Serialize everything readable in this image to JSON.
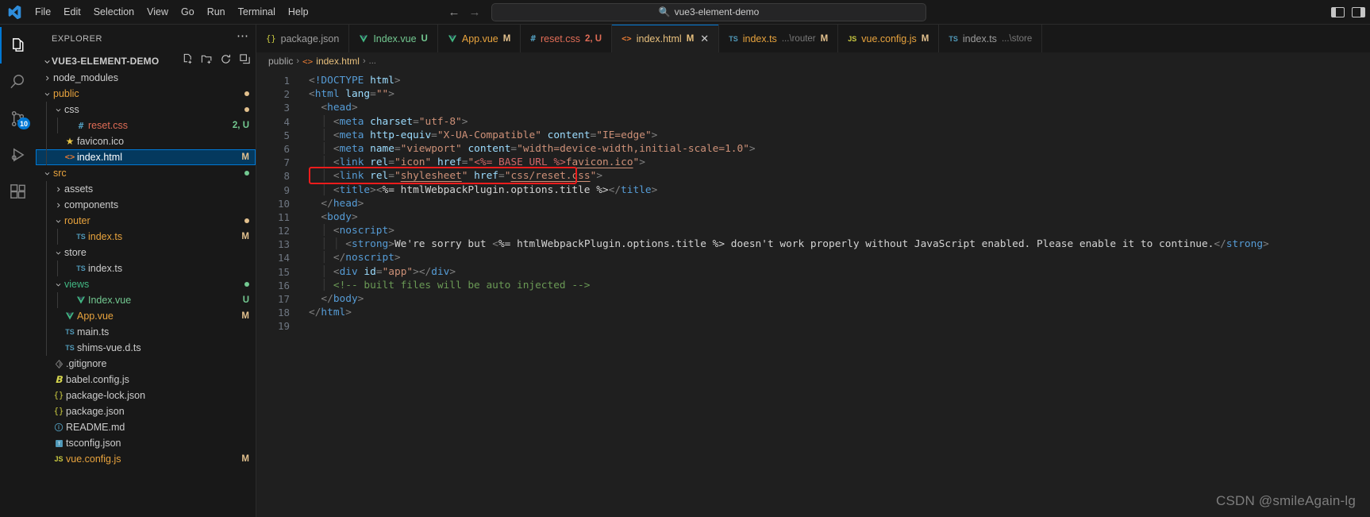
{
  "titlebar": {
    "menu": [
      "File",
      "Edit",
      "Selection",
      "View",
      "Go",
      "Run",
      "Terminal",
      "Help"
    ],
    "back_icon": "arrow-left-icon",
    "forward_icon": "arrow-right-icon",
    "search_value": "vue3-element-demo",
    "search_icon": "search-icon",
    "layout_left_icon": "layout-sidebar-left-icon",
    "layout_right_icon": "layout-sidebar-right-icon"
  },
  "activitybar": {
    "items": [
      {
        "name": "explorer",
        "icon": "files-icon",
        "active": true,
        "badge": ""
      },
      {
        "name": "search",
        "icon": "search-icon",
        "active": false,
        "badge": ""
      },
      {
        "name": "source-control",
        "icon": "source-control-icon",
        "active": false,
        "badge": "10"
      },
      {
        "name": "run-and-debug",
        "icon": "run-debug-icon",
        "active": false,
        "badge": ""
      },
      {
        "name": "extensions",
        "icon": "extensions-icon",
        "active": false,
        "badge": ""
      }
    ]
  },
  "sidebar": {
    "title": "EXPLORER",
    "more_icon": "ellipsis-icon",
    "root": "VUE3-ELEMENT-DEMO",
    "root_actions": [
      {
        "name": "new-file",
        "icon": "new-file-icon"
      },
      {
        "name": "new-folder",
        "icon": "new-folder-icon"
      },
      {
        "name": "refresh-explorer",
        "icon": "refresh-icon"
      },
      {
        "name": "collapse-folders",
        "icon": "collapse-all-icon"
      }
    ],
    "tree": [
      {
        "label": "node_modules",
        "type": "folder",
        "depth": 1,
        "expanded": false,
        "icon": "chevron-right-icon",
        "color": "#cccccc",
        "badge": "",
        "dot": ""
      },
      {
        "label": "public",
        "type": "folder",
        "depth": 1,
        "expanded": true,
        "icon": "chevron-down-icon",
        "color": "#e8a33d",
        "badge": "",
        "dot": "#e2c08d"
      },
      {
        "label": "css",
        "type": "folder",
        "depth": 2,
        "expanded": true,
        "icon": "chevron-down-icon",
        "color": "#cccccc",
        "badge": "",
        "dot": "#e2c08d"
      },
      {
        "label": "reset.css",
        "type": "file",
        "depth": 3,
        "icon": "hash-icon",
        "icon_color": "#519aba",
        "color": "#e06c56",
        "badge": "2, U",
        "badge_color": "#73c991",
        "dot": ""
      },
      {
        "label": "favicon.ico",
        "type": "file",
        "depth": 2,
        "icon": "star-icon",
        "icon_color": "#e8c547",
        "color": "#cccccc",
        "badge": "",
        "dot": ""
      },
      {
        "label": "index.html",
        "type": "file",
        "depth": 2,
        "icon": "code-brackets-icon",
        "icon_color": "#e37933",
        "color": "#ffffff",
        "badge": "M",
        "badge_color": "#e2c08d",
        "selected": true,
        "dot": ""
      },
      {
        "label": "src",
        "type": "folder",
        "depth": 1,
        "expanded": true,
        "icon": "chevron-down-icon",
        "color": "#e8a33d",
        "badge": "",
        "dot": "#73c991"
      },
      {
        "label": "assets",
        "type": "folder",
        "depth": 2,
        "expanded": false,
        "icon": "chevron-right-icon",
        "color": "#cccccc",
        "badge": "",
        "dot": ""
      },
      {
        "label": "components",
        "type": "folder",
        "depth": 2,
        "expanded": false,
        "icon": "chevron-right-icon",
        "color": "#cccccc",
        "badge": "",
        "dot": ""
      },
      {
        "label": "router",
        "type": "folder",
        "depth": 2,
        "expanded": true,
        "icon": "chevron-down-icon",
        "color": "#e8a33d",
        "badge": "",
        "dot": "#e2c08d"
      },
      {
        "label": "index.ts",
        "type": "file",
        "depth": 3,
        "icon": "ts-icon",
        "icon_color": "#519aba",
        "color": "#e8a33d",
        "badge": "M",
        "badge_color": "#e2c08d",
        "dot": ""
      },
      {
        "label": "store",
        "type": "folder",
        "depth": 2,
        "expanded": true,
        "icon": "chevron-down-icon",
        "color": "#cccccc",
        "badge": "",
        "dot": ""
      },
      {
        "label": "index.ts",
        "type": "file",
        "depth": 3,
        "icon": "ts-icon",
        "icon_color": "#519aba",
        "color": "#cccccc",
        "badge": "",
        "dot": ""
      },
      {
        "label": "views",
        "type": "folder",
        "depth": 2,
        "expanded": true,
        "icon": "chevron-down-icon",
        "color": "#42b883",
        "badge": "",
        "dot": "#73c991"
      },
      {
        "label": "Index.vue",
        "type": "file",
        "depth": 3,
        "icon": "vue-icon",
        "icon_color": "#41b883",
        "color": "#73c991",
        "badge": "U",
        "badge_color": "#73c991",
        "dot": ""
      },
      {
        "label": "App.vue",
        "type": "file",
        "depth": 2,
        "icon": "vue-icon",
        "icon_color": "#41b883",
        "color": "#e8a33d",
        "badge": "M",
        "badge_color": "#e2c08d",
        "dot": ""
      },
      {
        "label": "main.ts",
        "type": "file",
        "depth": 2,
        "icon": "ts-icon",
        "icon_color": "#519aba",
        "color": "#cccccc",
        "badge": "",
        "dot": ""
      },
      {
        "label": "shims-vue.d.ts",
        "type": "file",
        "depth": 2,
        "icon": "ts-icon",
        "icon_color": "#519aba",
        "color": "#cccccc",
        "badge": "",
        "dot": ""
      },
      {
        "label": ".gitignore",
        "type": "file",
        "depth": 1,
        "icon": "git-icon",
        "icon_color": "#8a8a8a",
        "color": "#cccccc",
        "badge": "",
        "dot": ""
      },
      {
        "label": "babel.config.js",
        "type": "file",
        "depth": 1,
        "icon": "babel-icon",
        "icon_color": "#d6d64e",
        "color": "#cccccc",
        "badge": "",
        "dot": ""
      },
      {
        "label": "package-lock.json",
        "type": "file",
        "depth": 1,
        "icon": "json-icon",
        "icon_color": "#cbcb41",
        "color": "#cccccc",
        "badge": "",
        "dot": ""
      },
      {
        "label": "package.json",
        "type": "file",
        "depth": 1,
        "icon": "json-icon",
        "icon_color": "#cbcb41",
        "color": "#cccccc",
        "badge": "",
        "dot": ""
      },
      {
        "label": "README.md",
        "type": "file",
        "depth": 1,
        "icon": "info-icon",
        "icon_color": "#519aba",
        "color": "#cccccc",
        "badge": "",
        "dot": ""
      },
      {
        "label": "tsconfig.json",
        "type": "file",
        "depth": 1,
        "icon": "tsconfig-icon",
        "icon_color": "#519aba",
        "color": "#cccccc",
        "badge": "",
        "dot": ""
      },
      {
        "label": "vue.config.js",
        "type": "file",
        "depth": 1,
        "icon": "js-icon",
        "icon_color": "#cbcb41",
        "color": "#e8a33d",
        "badge": "M",
        "badge_color": "#e2c08d",
        "dot": ""
      }
    ]
  },
  "tabs": [
    {
      "name": "package.json",
      "icon": "json-icon",
      "icon_color": "#cbcb41",
      "state": "",
      "state_color": "",
      "path": "",
      "active": false,
      "close": false,
      "label_color": "#9d9d9d"
    },
    {
      "name": "Index.vue",
      "icon": "vue-icon",
      "icon_color": "#41b883",
      "state": "U",
      "state_color": "#73c991",
      "path": "",
      "active": false,
      "close": false,
      "label_color": "#73c991"
    },
    {
      "name": "App.vue",
      "icon": "vue-icon",
      "icon_color": "#41b883",
      "state": "M",
      "state_color": "#e2c08d",
      "path": "",
      "active": false,
      "close": false,
      "label_color": "#e8a33d"
    },
    {
      "name": "reset.css",
      "icon": "hash-icon",
      "icon_color": "#519aba",
      "state": "2, U",
      "state_color": "#e06c56",
      "path": "",
      "active": false,
      "close": false,
      "label_color": "#e06c56"
    },
    {
      "name": "index.html",
      "icon": "code-brackets-icon",
      "icon_color": "#e37933",
      "state": "M",
      "state_color": "#e8c07d",
      "path": "",
      "active": true,
      "close": true,
      "label_color": "#e8c07d"
    },
    {
      "name": "index.ts",
      "icon": "ts-icon",
      "icon_color": "#519aba",
      "state": "M",
      "state_color": "#e2c08d",
      "path": "...\\router",
      "active": false,
      "close": false,
      "label_color": "#e8a33d"
    },
    {
      "name": "vue.config.js",
      "icon": "js-icon",
      "icon_color": "#cbcb41",
      "state": "M",
      "state_color": "#e2c08d",
      "path": "",
      "active": false,
      "close": false,
      "label_color": "#e8a33d"
    },
    {
      "name": "index.ts",
      "icon": "ts-icon",
      "icon_color": "#519aba",
      "state": "",
      "state_color": "",
      "path": "...\\store",
      "active": false,
      "close": false,
      "label_color": "#9d9d9d"
    }
  ],
  "breadcrumb": {
    "folder": "public",
    "file": "index.html",
    "file_icon": "code-brackets-icon",
    "tail": "..."
  },
  "editor": {
    "line_count": 19,
    "line_numbers": [
      "1",
      "2",
      "3",
      "4",
      "5",
      "6",
      "7",
      "8",
      "9",
      "10",
      "11",
      "12",
      "13",
      "14",
      "15",
      "16",
      "17",
      "18",
      "19"
    ],
    "lines": [
      "<!DOCTYPE html>",
      "<html lang=\"\">",
      "  <head>",
      "    <meta charset=\"utf-8\">",
      "    <meta http-equiv=\"X-UA-Compatible\" content=\"IE=edge\">",
      "    <meta name=\"viewport\" content=\"width=device-width,initial-scale=1.0\">",
      "    <link rel=\"icon\" href=\"<%= BASE_URL %>favicon.ico\">",
      "    <link rel=\"shylesheet\" href=\"css/reset.css\">",
      "    <title><%= htmlWebpackPlugin.options.title %></title>",
      "  </head>",
      "  <body>",
      "    <noscript>",
      "      <strong>We're sorry but <%= htmlWebpackPlugin.options.title %> doesn't work properly without JavaScript enabled. Please enable it to continue.</strong>",
      "    </noscript>",
      "    <div id=\"app\"></div>",
      "    <!-- built files will be auto injected -->",
      "  </body>",
      "</html>",
      ""
    ],
    "highlight_line": 8,
    "highlight_color": "#ee1c1c",
    "cursor_line": 8
  },
  "watermark": "CSDN @smileAgain-lg"
}
